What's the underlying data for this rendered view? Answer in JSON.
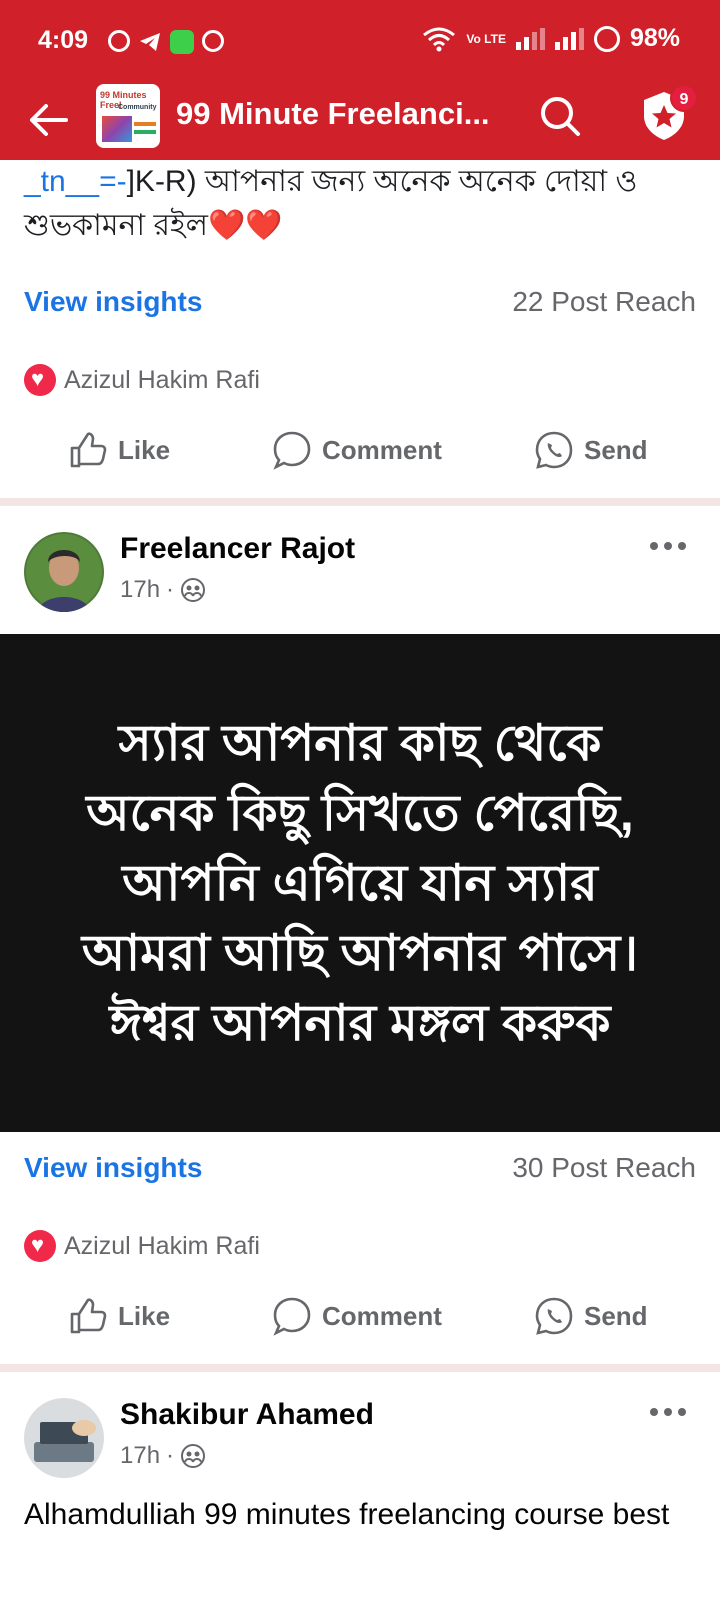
{
  "status_bar": {
    "time": "4:09",
    "network_label": "Vo LTE",
    "battery": "98%",
    "colors": {
      "bar": "#d0202a"
    }
  },
  "header": {
    "title": "99 Minute Freelanci...",
    "group_thumb_text": "99 Minutes Freel",
    "group_thumb_sub": "Community",
    "notification_count": "9"
  },
  "feed": {
    "prev_post": {
      "snippet_link": "_tn__=-",
      "snippet_text": "]K-R) আপনার জন্য অনেক অনেক দোয়া ও শুভকামনা রইল",
      "hearts": "❤️❤️",
      "insights_label": "View insights",
      "reach": "22 Post Reach",
      "reactor": "Azizul Hakim Rafi"
    },
    "post1": {
      "author": "Freelancer Rajot",
      "time": "17h",
      "text_card": "স্যার আপনার কাছ থেকে অনেক কিছু সিখতে পেরেছি, আপনি এগিয়ে যান স্যার আমরা আছি আপনার পাসে। ঈশ্বর আপনার মঙ্গল করুক",
      "insights_label": "View insights",
      "reach": "30 Post Reach",
      "reactor": "Azizul Hakim Rafi"
    },
    "post2": {
      "author": "Shakibur Ahamed",
      "time": "17h",
      "text": "Alhamdulliah 99 minutes freelancing course best"
    },
    "actions": {
      "like": "Like",
      "comment": "Comment",
      "send": "Send"
    }
  }
}
